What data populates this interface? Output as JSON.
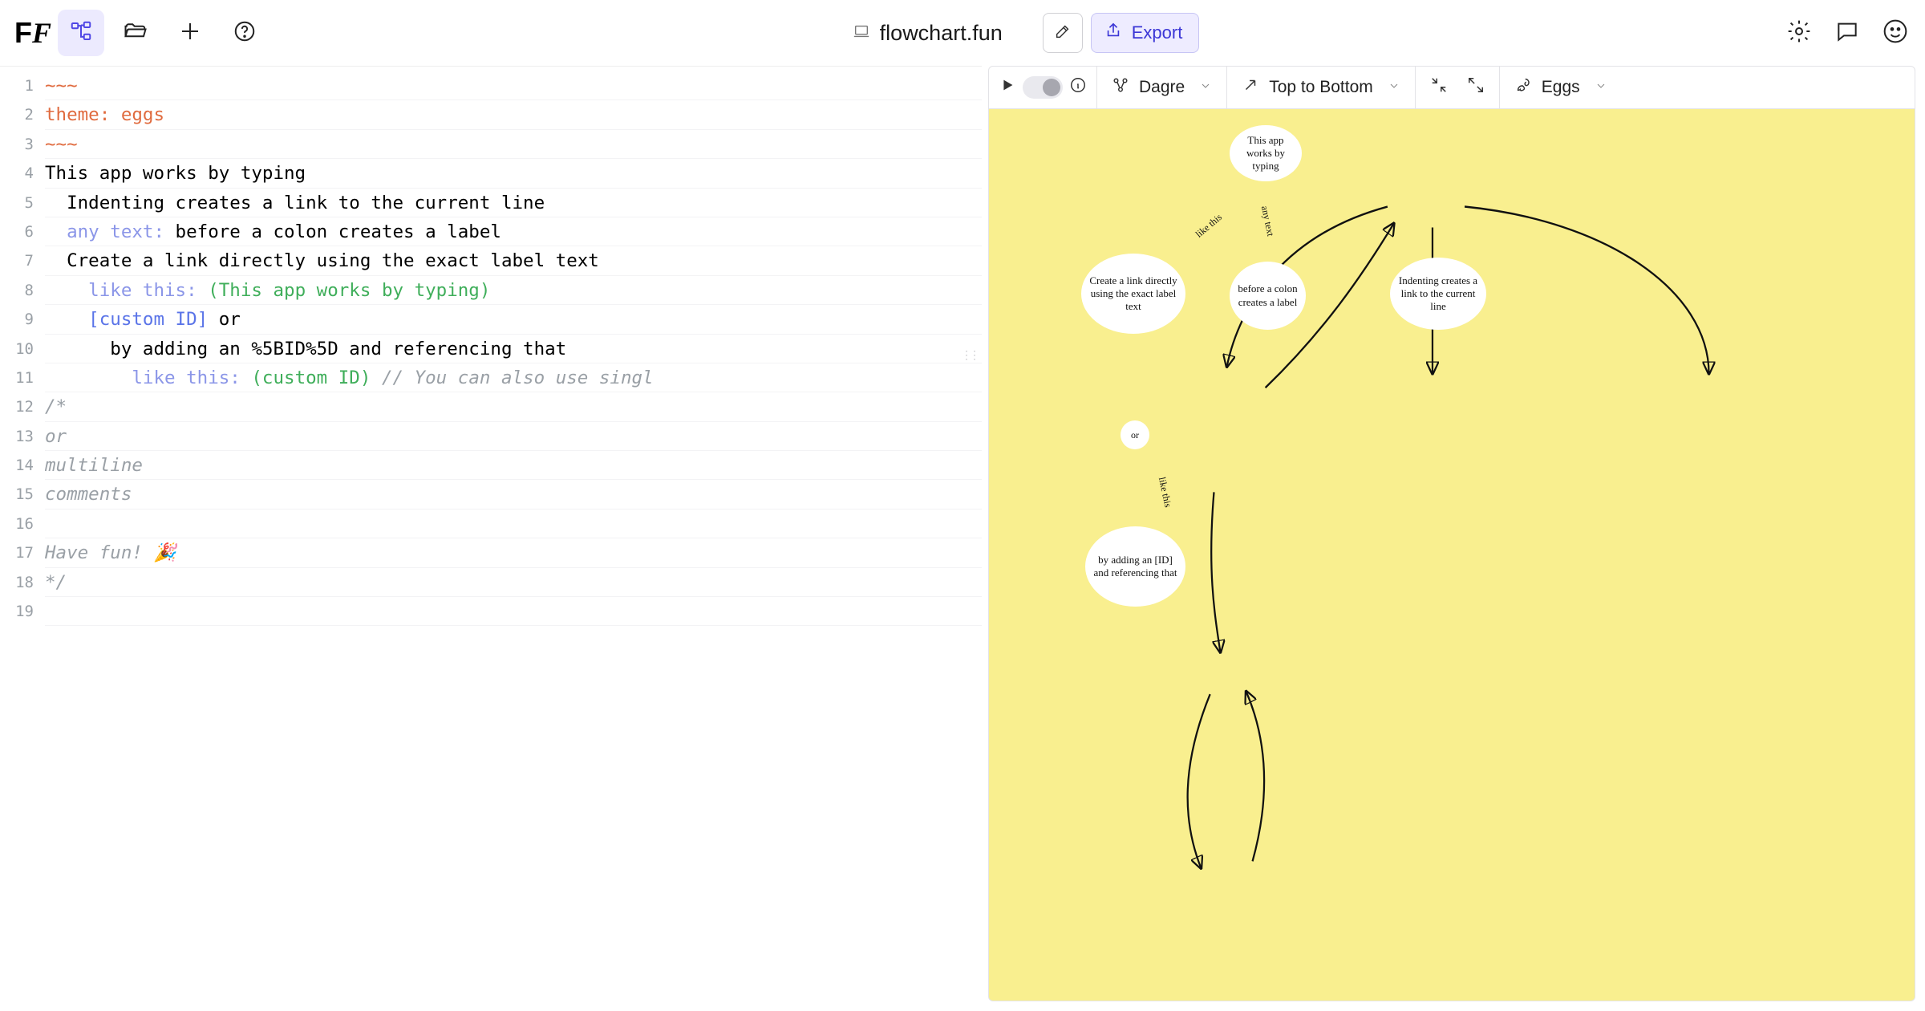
{
  "header": {
    "title": "flowchart.fun",
    "export_label": "Export"
  },
  "graph_toolbar": {
    "layout": "Dagre",
    "direction": "Top to Bottom",
    "theme": "Eggs"
  },
  "editor": {
    "line_count": 19,
    "lines": {
      "l1_delim": "~~~",
      "l2_key": "theme: ",
      "l2_val": "eggs",
      "l3_delim": "~~~",
      "l4": "This app works by typing",
      "l5": "  Indenting creates a link to the current line",
      "l6_label": "  any text:",
      "l6_rest": " before a colon creates a label",
      "l7": "  Create a link directly using the exact label text",
      "l8_label": "    like this:",
      "l8_ref": " (This app works by typing)",
      "l9_id": "    [custom ID]",
      "l9_rest": " or",
      "l10": "      by adding an %5BID%5D and referencing that",
      "l11_label": "        like this:",
      "l11_ref": " (custom ID)",
      "l11_comment": " // You can also use singl",
      "l12": "/*",
      "l13": "or",
      "l14": "multiline",
      "l15": "comments",
      "l16": "",
      "l17": "Have fun! 🎉",
      "l18": "*/",
      "l19": ""
    }
  },
  "nodes": {
    "n1": "This app works by typing",
    "n2": "Create a link directly using the exact label text",
    "n3": "before a colon creates a label",
    "n4": "Indenting creates a link to the current line",
    "n5": "or",
    "n6": "by adding an [ID] and referencing that"
  },
  "edge_labels": {
    "e1": "like this",
    "e2": "any text",
    "e3": "like this"
  },
  "icons": {
    "logo": "FF",
    "diagram": "diagram-icon",
    "folder": "folder-icon",
    "plus": "plus-icon",
    "help": "help-icon",
    "laptop": "laptop-icon",
    "edit": "edit-icon",
    "share": "share-icon",
    "settings": "settings-icon",
    "chat": "chat-icon",
    "user": "user-icon",
    "play": "play-icon",
    "info": "info-icon",
    "layout": "layout-icon",
    "arrow": "arrow-icon",
    "compress": "compress-icon",
    "expand": "expand-icon",
    "brush": "brush-icon"
  },
  "colors": {
    "accent": "#4f46e5",
    "canvas_bg": "#f9ef8f",
    "code_orange": "#e06b3f",
    "code_blue": "#5a74e8",
    "code_green": "#3fae5a"
  }
}
